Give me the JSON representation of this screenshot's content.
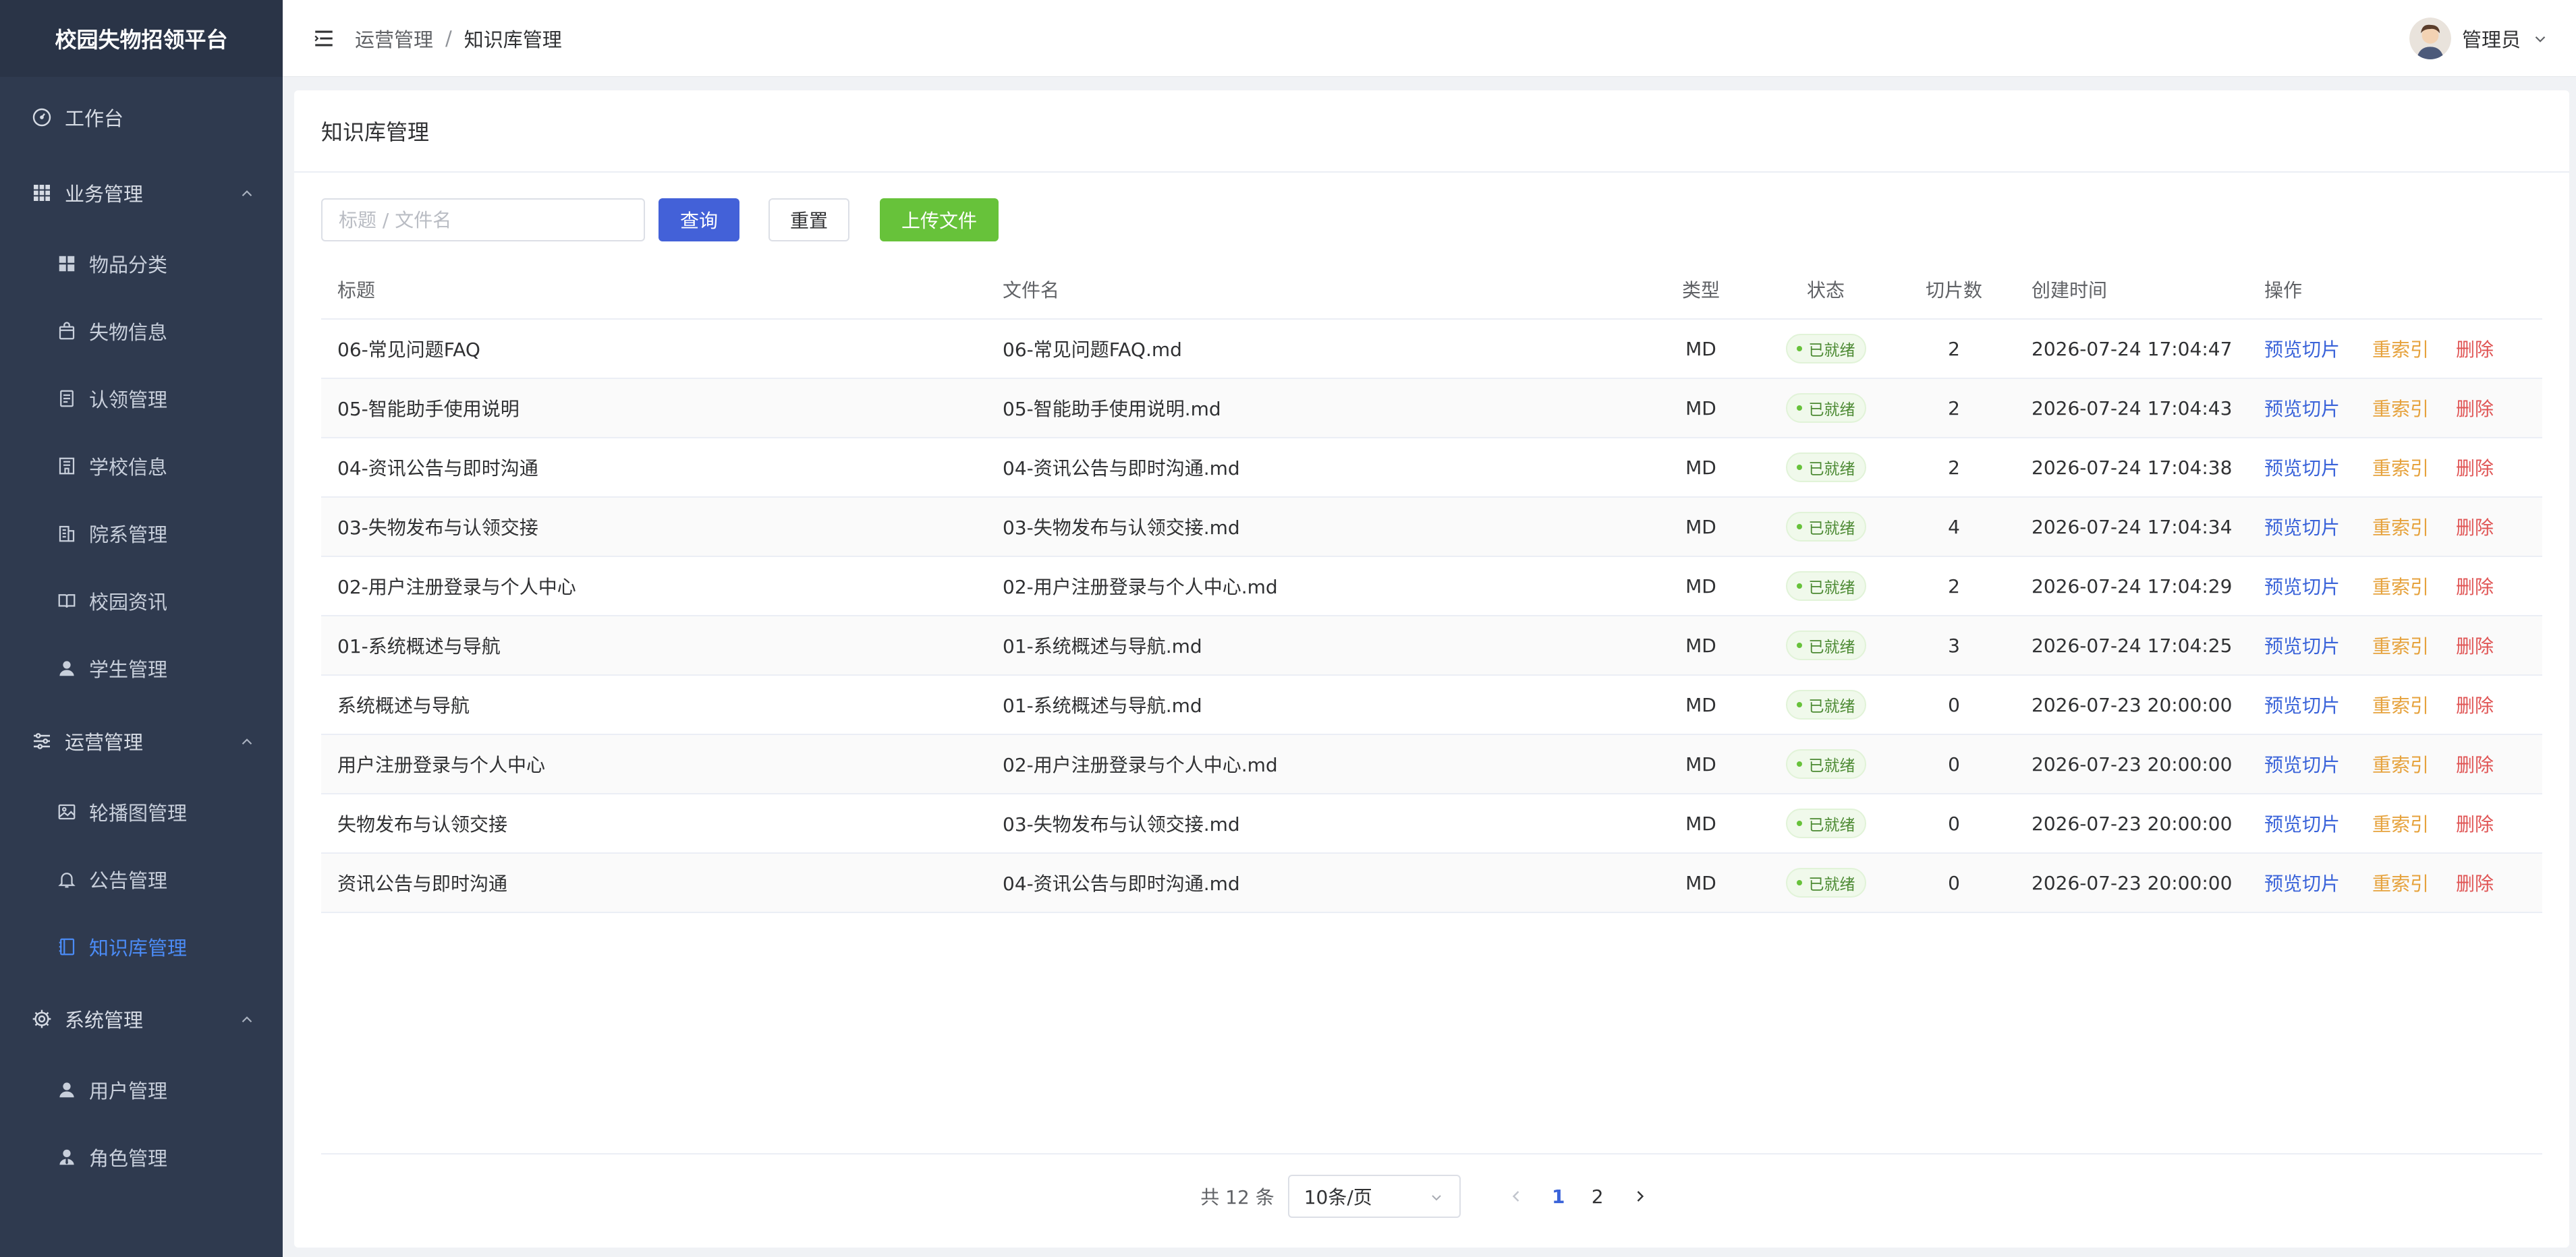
{
  "app": {
    "title": "校园失物招领平台"
  },
  "sidebar": {
    "workbench": "工作台",
    "groups": [
      {
        "label": "业务管理",
        "items": [
          "物品分类",
          "失物信息",
          "认领管理",
          "学校信息",
          "院系管理",
          "校园资讯",
          "学生管理"
        ]
      },
      {
        "label": "运营管理",
        "items": [
          "轮播图管理",
          "公告管理",
          "知识库管理"
        ]
      },
      {
        "label": "系统管理",
        "items": [
          "用户管理",
          "角色管理"
        ]
      }
    ],
    "active_item": "知识库管理"
  },
  "header": {
    "breadcrumb": [
      "运营管理",
      "知识库管理"
    ],
    "breadcrumb_sep": "/",
    "username": "管理员"
  },
  "page": {
    "title": "知识库管理"
  },
  "toolbar": {
    "search_placeholder": "标题 / 文件名",
    "search_value": "",
    "query_label": "查询",
    "reset_label": "重置",
    "upload_label": "上传文件"
  },
  "table": {
    "columns": [
      "标题",
      "文件名",
      "类型",
      "状态",
      "切片数",
      "创建时间",
      "操作"
    ],
    "actions": {
      "preview": "预览切片",
      "reindex": "重索引",
      "delete": "删除"
    },
    "rows": [
      {
        "title": "06-常见问题FAQ",
        "filename": "06-常见问题FAQ.md",
        "type": "MD",
        "status": "已就绪",
        "slices": "2",
        "created": "2026-07-24 17:04:47"
      },
      {
        "title": "05-智能助手使用说明",
        "filename": "05-智能助手使用说明.md",
        "type": "MD",
        "status": "已就绪",
        "slices": "2",
        "created": "2026-07-24 17:04:43"
      },
      {
        "title": "04-资讯公告与即时沟通",
        "filename": "04-资讯公告与即时沟通.md",
        "type": "MD",
        "status": "已就绪",
        "slices": "2",
        "created": "2026-07-24 17:04:38"
      },
      {
        "title": "03-失物发布与认领交接",
        "filename": "03-失物发布与认领交接.md",
        "type": "MD",
        "status": "已就绪",
        "slices": "4",
        "created": "2026-07-24 17:04:34"
      },
      {
        "title": "02-用户注册登录与个人中心",
        "filename": "02-用户注册登录与个人中心.md",
        "type": "MD",
        "status": "已就绪",
        "slices": "2",
        "created": "2026-07-24 17:04:29"
      },
      {
        "title": "01-系统概述与导航",
        "filename": "01-系统概述与导航.md",
        "type": "MD",
        "status": "已就绪",
        "slices": "3",
        "created": "2026-07-24 17:04:25"
      },
      {
        "title": "系统概述与导航",
        "filename": "01-系统概述与导航.md",
        "type": "MD",
        "status": "已就绪",
        "slices": "0",
        "created": "2026-07-23 20:00:00"
      },
      {
        "title": "用户注册登录与个人中心",
        "filename": "02-用户注册登录与个人中心.md",
        "type": "MD",
        "status": "已就绪",
        "slices": "0",
        "created": "2026-07-23 20:00:00"
      },
      {
        "title": "失物发布与认领交接",
        "filename": "03-失物发布与认领交接.md",
        "type": "MD",
        "status": "已就绪",
        "slices": "0",
        "created": "2026-07-23 20:00:00"
      },
      {
        "title": "资讯公告与即时沟通",
        "filename": "04-资讯公告与即时沟通.md",
        "type": "MD",
        "status": "已就绪",
        "slices": "0",
        "created": "2026-07-23 20:00:00"
      }
    ]
  },
  "pagination": {
    "total_text": "共 12 条",
    "page_size": "10条/页",
    "pages": [
      "1",
      "2"
    ],
    "current": "1"
  },
  "colors": {
    "sidebar_bg": "#2f3a4f",
    "accent": "#4361d8",
    "success": "#67c23a",
    "warning": "#e6a23c",
    "danger": "#e05656",
    "active_menu": "#4b8bf5"
  }
}
